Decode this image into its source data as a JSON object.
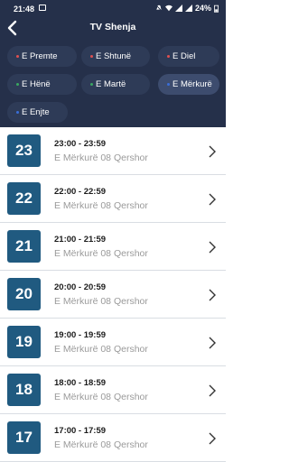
{
  "status_bar": {
    "time": "21:48",
    "battery": "24%"
  },
  "header": {
    "title": "TV Shenja"
  },
  "days": [
    {
      "label": "E Premte",
      "dot_color": "#e05050"
    },
    {
      "label": "E Shtunë",
      "dot_color": "#e05050"
    },
    {
      "label": "E Diel",
      "dot_color": "#e05050"
    },
    {
      "label": "E Hënë",
      "dot_color": "#3aa860"
    },
    {
      "label": "E Martë",
      "dot_color": "#3aa860"
    },
    {
      "label": "E Mërkurë",
      "dot_color": "#3a6ed8",
      "selected": true
    },
    {
      "label": "E Enjte",
      "dot_color": "#3a6ed8"
    }
  ],
  "schedule": [
    {
      "hour": "23",
      "time": "23:00 - 23:59",
      "date": "E Mërkurë 08 Qershor"
    },
    {
      "hour": "22",
      "time": "22:00 - 22:59",
      "date": "E Mërkurë 08 Qershor"
    },
    {
      "hour": "21",
      "time": "21:00 - 21:59",
      "date": "E Mërkurë 08 Qershor"
    },
    {
      "hour": "20",
      "time": "20:00 - 20:59",
      "date": "E Mërkurë 08 Qershor"
    },
    {
      "hour": "19",
      "time": "19:00 - 19:59",
      "date": "E Mërkurë 08 Qershor"
    },
    {
      "hour": "18",
      "time": "18:00 - 18:59",
      "date": "E Mërkurë 08 Qershor"
    },
    {
      "hour": "17",
      "time": "17:00 - 17:59",
      "date": "E Mërkurë 08 Qershor"
    }
  ]
}
